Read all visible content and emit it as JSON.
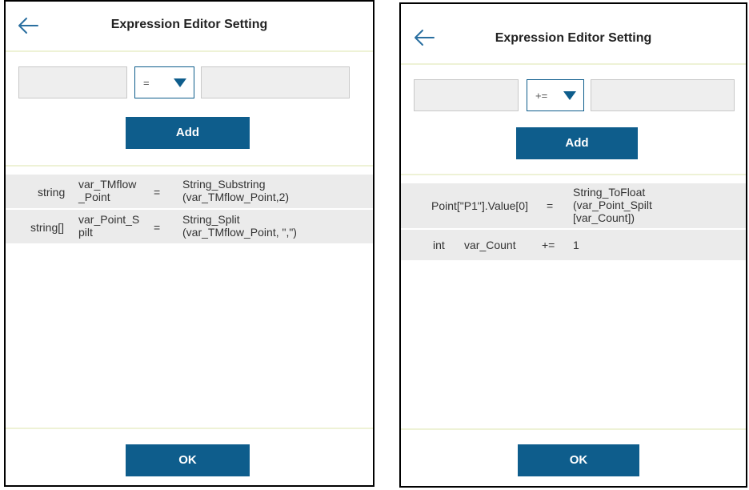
{
  "left_panel": {
    "title": "Expression Editor Setting",
    "operator": "=",
    "add_label": "Add",
    "ok_label": "OK",
    "expressions": [
      {
        "type": "string",
        "var_line1": "var_TMflow",
        "var_line2": "_Point",
        "op": "=",
        "value_line1": "String_Substring",
        "value_line2": "(var_TMflow_Point,2)"
      },
      {
        "type": "string[]",
        "var_line1": "var_Point_S",
        "var_line2": "pilt",
        "op": "=",
        "value_line1": "String_Split",
        "value_line2": "(var_TMflow_Point, \",\")"
      }
    ]
  },
  "right_panel": {
    "title": "Expression Editor Setting",
    "operator": "+=",
    "add_label": "Add",
    "ok_label": "OK",
    "expressions": [
      {
        "target": "Point[\"P1\"].Value[0]",
        "op": "=",
        "value_line1": "String_ToFloat",
        "value_line2": "(var_Point_Spilt",
        "value_line3": "[var_Count])"
      },
      {
        "type": "int",
        "var": "var_Count",
        "op": "+=",
        "value": "1"
      }
    ]
  },
  "colors": {
    "accent": "#0e5d8c",
    "row_bg": "#ebebeb",
    "separator": "#eef2d6",
    "input_bg": "#eeeeee"
  },
  "icons": {
    "back": "arrow-left-icon",
    "dropdown": "triangle-down-icon"
  }
}
